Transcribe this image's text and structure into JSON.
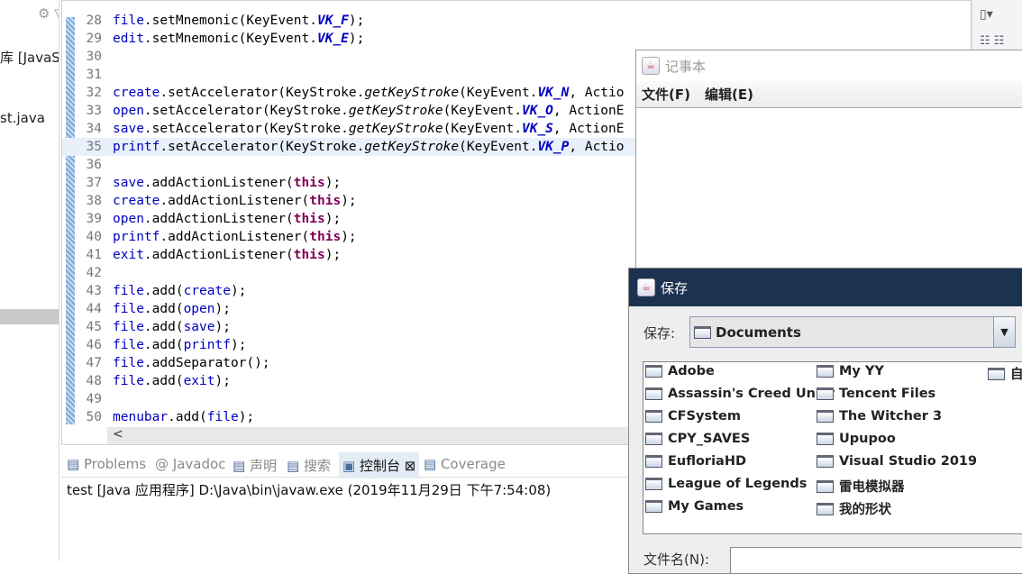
{
  "left_panel": {
    "items": [
      "库 [JavaS",
      "st.java"
    ]
  },
  "editor": {
    "lines": [
      {
        "n": "28",
        "seg": [
          [
            "file",
            "f"
          ],
          [
            ".setMnemonic(KeyEvent.",
            ""
          ],
          [
            "VK_F",
            "c"
          ],
          [
            ");",
            ""
          ]
        ]
      },
      {
        "n": "29",
        "seg": [
          [
            "edit",
            "f"
          ],
          [
            ".setMnemonic(KeyEvent.",
            ""
          ],
          [
            "VK_E",
            "c"
          ],
          [
            ");",
            ""
          ]
        ]
      },
      {
        "n": "30",
        "seg": []
      },
      {
        "n": "31",
        "seg": []
      },
      {
        "n": "32",
        "seg": [
          [
            "create",
            "f"
          ],
          [
            ".setAccelerator(KeyStroke.",
            ""
          ],
          [
            "getKeyStroke",
            "i"
          ],
          [
            "(KeyEvent.",
            ""
          ],
          [
            "VK_N",
            "c"
          ],
          [
            ", Actio",
            ""
          ]
        ]
      },
      {
        "n": "33",
        "seg": [
          [
            "open",
            "f"
          ],
          [
            ".setAccelerator(KeyStroke.",
            ""
          ],
          [
            "getKeyStroke",
            "i"
          ],
          [
            "(KeyEvent.",
            ""
          ],
          [
            "VK_O",
            "c"
          ],
          [
            ", ActionE",
            ""
          ]
        ]
      },
      {
        "n": "34",
        "seg": [
          [
            "save",
            "f"
          ],
          [
            ".setAccelerator(KeyStroke.",
            ""
          ],
          [
            "getKeyStroke",
            "i"
          ],
          [
            "(KeyEvent.",
            ""
          ],
          [
            "VK_S",
            "c"
          ],
          [
            ", ActionE",
            ""
          ]
        ]
      },
      {
        "n": "35",
        "seg": [
          [
            "printf",
            "f"
          ],
          [
            ".setAccelerator(KeyStroke.",
            ""
          ],
          [
            "getKeyStroke",
            "i"
          ],
          [
            "(KeyEvent.",
            ""
          ],
          [
            "VK_P",
            "c"
          ],
          [
            ", Actio",
            ""
          ]
        ],
        "hl": true
      },
      {
        "n": "36",
        "seg": []
      },
      {
        "n": "37",
        "seg": [
          [
            "save",
            "f"
          ],
          [
            ".addActionListener(",
            ""
          ],
          [
            "this",
            "k"
          ],
          [
            ");",
            ""
          ]
        ]
      },
      {
        "n": "38",
        "seg": [
          [
            "create",
            "f"
          ],
          [
            ".addActionListener(",
            ""
          ],
          [
            "this",
            "k"
          ],
          [
            ");",
            ""
          ]
        ]
      },
      {
        "n": "39",
        "seg": [
          [
            "open",
            "f"
          ],
          [
            ".addActionListener(",
            ""
          ],
          [
            "this",
            "k"
          ],
          [
            ");",
            ""
          ]
        ]
      },
      {
        "n": "40",
        "seg": [
          [
            "printf",
            "f"
          ],
          [
            ".addActionListener(",
            ""
          ],
          [
            "this",
            "k"
          ],
          [
            ");",
            ""
          ]
        ]
      },
      {
        "n": "41",
        "seg": [
          [
            "exit",
            "f"
          ],
          [
            ".addActionListener(",
            ""
          ],
          [
            "this",
            "k"
          ],
          [
            ");",
            ""
          ]
        ]
      },
      {
        "n": "42",
        "seg": []
      },
      {
        "n": "43",
        "seg": [
          [
            "file",
            "f"
          ],
          [
            ".add(",
            ""
          ],
          [
            "create",
            "f"
          ],
          [
            ");",
            ""
          ]
        ]
      },
      {
        "n": "44",
        "seg": [
          [
            "file",
            "f"
          ],
          [
            ".add(",
            ""
          ],
          [
            "open",
            "f"
          ],
          [
            ");",
            ""
          ]
        ]
      },
      {
        "n": "45",
        "seg": [
          [
            "file",
            "f"
          ],
          [
            ".add(",
            ""
          ],
          [
            "save",
            "f"
          ],
          [
            ");",
            ""
          ]
        ]
      },
      {
        "n": "46",
        "seg": [
          [
            "file",
            "f"
          ],
          [
            ".add(",
            ""
          ],
          [
            "printf",
            "f"
          ],
          [
            ");",
            ""
          ]
        ]
      },
      {
        "n": "47",
        "seg": [
          [
            "file",
            "f"
          ],
          [
            ".addSeparator();",
            ""
          ]
        ]
      },
      {
        "n": "48",
        "seg": [
          [
            "file",
            "f"
          ],
          [
            ".add(",
            ""
          ],
          [
            "exit",
            "f"
          ],
          [
            ");",
            ""
          ]
        ]
      },
      {
        "n": "49",
        "seg": []
      },
      {
        "n": "50",
        "seg": [
          [
            "menubar",
            "f"
          ],
          [
            ".add(",
            ""
          ],
          [
            "file",
            "f"
          ],
          [
            ");",
            ""
          ]
        ]
      }
    ],
    "scroll_left": "<"
  },
  "bottom": {
    "tabs": [
      {
        "label": "Problems",
        "icon": "problems-icon"
      },
      {
        "label": "@ Javadoc",
        "icon": "javadoc-icon"
      },
      {
        "label": "声明",
        "icon": "declaration-icon"
      },
      {
        "label": "搜索",
        "icon": "search-icon"
      },
      {
        "label": "控制台 ⊠",
        "icon": "console-icon",
        "active": true
      },
      {
        "label": "Coverage",
        "icon": "coverage-icon"
      }
    ],
    "console": "test [Java 应用程序] D:\\Java\\bin\\javaw.exe  (2019年11月29日 下午7:54:08)"
  },
  "notepad": {
    "title": "记事本",
    "menus": [
      "文件(F)",
      "编辑(E)"
    ]
  },
  "save_dialog": {
    "title": "保存",
    "look_in_label": "保存:",
    "look_in_value": "Documents",
    "filename_label": "文件名(N):",
    "folders": [
      [
        "Adobe",
        "Assassin's Creed Unity",
        "CFSystem",
        "CPY_SAVES",
        "EufloriaHD",
        "League of Legends",
        "My Games"
      ],
      [
        "My YY",
        "Tencent Files",
        "The Witcher 3",
        "Upupoo",
        "Visual Studio 2019",
        "雷电模拟器",
        "我的形状"
      ],
      [
        "自"
      ]
    ]
  }
}
